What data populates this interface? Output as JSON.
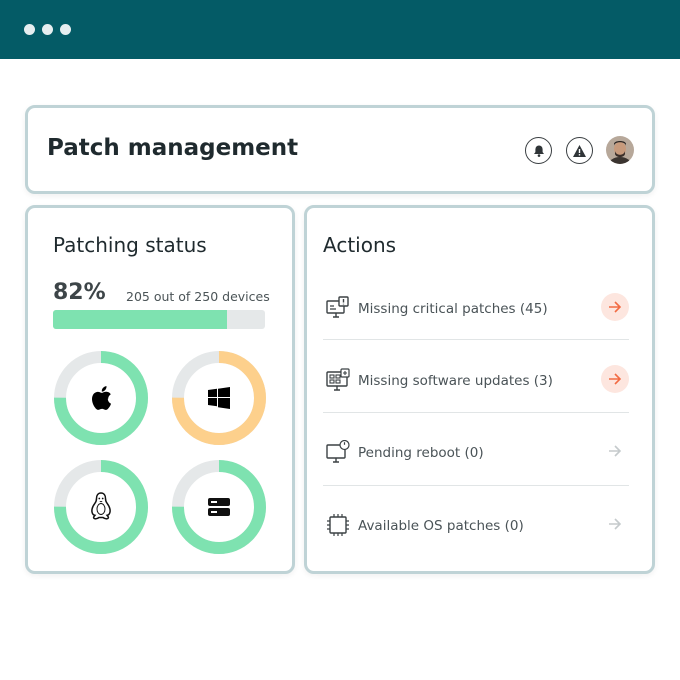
{
  "window": {
    "controls": [
      "dot",
      "dot",
      "dot"
    ]
  },
  "header": {
    "title": "Patch management",
    "icons": [
      "bell-icon",
      "warning-icon"
    ],
    "avatar": "user-avatar"
  },
  "status": {
    "title": "Patching status",
    "percent_label": "82%",
    "percent": 82,
    "devices_label": "205 out of 250 devices",
    "rings": [
      {
        "os": "apple-icon",
        "fraction": 0.75,
        "color": "#7ee2b0"
      },
      {
        "os": "windows-icon",
        "fraction": 0.75,
        "color": "#fdd08c"
      },
      {
        "os": "linux-icon",
        "fraction": 0.75,
        "color": "#7ee2b0"
      },
      {
        "os": "server-icon",
        "fraction": 0.75,
        "color": "#7ee2b0"
      }
    ],
    "ring_track_color": "#e5e8e9"
  },
  "actions": {
    "title": "Actions",
    "items": [
      {
        "label": "Missing critical patches (45)",
        "icon": "monitor-alert-icon",
        "active": true
      },
      {
        "label": "Missing software updates (3)",
        "icon": "monitor-apps-icon",
        "active": true
      },
      {
        "label": "Pending reboot (0)",
        "icon": "monitor-power-icon",
        "active": false
      },
      {
        "label": "Available OS patches (0)",
        "icon": "chip-icon",
        "active": false
      }
    ],
    "arrow_active_color": "#f26b43",
    "arrow_inactive_color": "#c5cacc"
  },
  "colors": {
    "topbar": "#045b66",
    "border": "#bfd3d6"
  }
}
